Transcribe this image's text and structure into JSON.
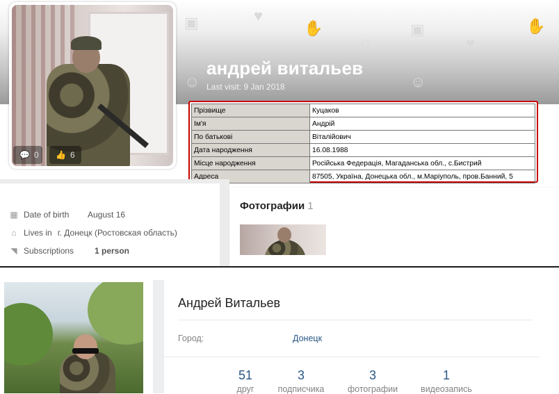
{
  "profile": {
    "name": "андрей витальев",
    "last_visit": "Last visit: 9 Jan 2018",
    "counters": {
      "comments": "0",
      "likes": "6"
    },
    "info_table": [
      {
        "key": "Прізвище",
        "value": "Куцаков"
      },
      {
        "key": "Ім'я",
        "value": "Андрій"
      },
      {
        "key": "По батькові",
        "value": "Віталійович"
      },
      {
        "key": "Дата народження",
        "value": "16.08.1988"
      },
      {
        "key": "Місце народження",
        "value": "Російська Федерація, Магаданська обл., с.Бистрий"
      },
      {
        "key": "Адреса",
        "value": "87505, Україна, Донецька обл., м.Маріуполь, пров.Банний, 5"
      }
    ],
    "details": {
      "birth_label": "Date of birth",
      "birth_value": "August 16",
      "lives_label": "Lives in",
      "lives_value": "г. Донецк (Ростовская область)",
      "subs_label": "Subscriptions",
      "subs_value": "1 person"
    },
    "photos": {
      "title": "Фотографии",
      "count": "1"
    }
  },
  "vk": {
    "name": "Андрей Витальев",
    "city_label": "Город:",
    "city_value": "Донецк",
    "stats": [
      {
        "num": "51",
        "label": "друг"
      },
      {
        "num": "3",
        "label": "подписчика"
      },
      {
        "num": "3",
        "label": "фотографии"
      },
      {
        "num": "1",
        "label": "видеозапись"
      }
    ]
  },
  "colors": {
    "highlight_border": "#c80000",
    "link": "#2a5885"
  }
}
